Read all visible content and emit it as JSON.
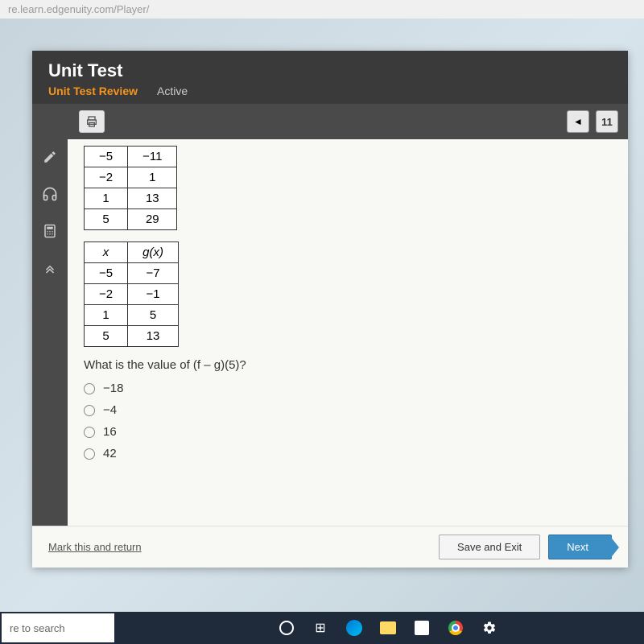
{
  "url": "re.learn.edgenuity.com/Player/",
  "header": {
    "title": "Unit Test",
    "subtitle": "Unit Test Review",
    "status": "Active"
  },
  "toolbar": {
    "question_number": "11"
  },
  "chart_data": [
    {
      "type": "table",
      "rows": [
        {
          "x": "−5",
          "y": "−11"
        },
        {
          "x": "−2",
          "y": "1"
        },
        {
          "x": "1",
          "y": "13"
        },
        {
          "x": "5",
          "y": "29"
        }
      ]
    },
    {
      "type": "table",
      "header": {
        "col1": "x",
        "col2": "g(x)"
      },
      "rows": [
        {
          "x": "−5",
          "y": "−7"
        },
        {
          "x": "−2",
          "y": "−1"
        },
        {
          "x": "1",
          "y": "5"
        },
        {
          "x": "5",
          "y": "13"
        }
      ]
    }
  ],
  "question": "What is the value of (f – g)(5)?",
  "options": [
    "−18",
    "−4",
    "16",
    "42"
  ],
  "footer": {
    "mark": "Mark this and return",
    "save": "Save and Exit",
    "next": "Next"
  },
  "taskbar": {
    "search": "re to search"
  }
}
